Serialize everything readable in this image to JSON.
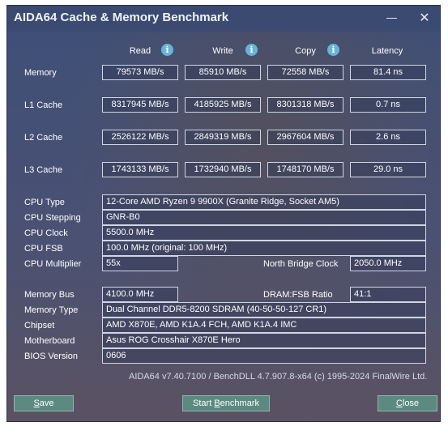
{
  "window": {
    "title": "AIDA64 Cache & Memory Benchmark",
    "minimize_icon": "minimize-icon",
    "close_icon": "close-icon",
    "close_glyph": "✕"
  },
  "columns": {
    "read": "Read",
    "write": "Write",
    "copy": "Copy",
    "latency": "Latency",
    "info_glyph": "i"
  },
  "bench": {
    "memory": {
      "label": "Memory",
      "read": "79573 MB/s",
      "write": "85910 MB/s",
      "copy": "72558 MB/s",
      "latency": "81.4 ns"
    },
    "l1": {
      "label": "L1 Cache",
      "read": "8317945 MB/s",
      "write": "4185925 MB/s",
      "copy": "8301318 MB/s",
      "latency": "0.7 ns"
    },
    "l2": {
      "label": "L2 Cache",
      "read": "2526122 MB/s",
      "write": "2849319 MB/s",
      "copy": "2967604 MB/s",
      "latency": "2.6 ns"
    },
    "l3": {
      "label": "L3 Cache",
      "read": "1743133 MB/s",
      "write": "1732940 MB/s",
      "copy": "1748170 MB/s",
      "latency": "29.0 ns"
    }
  },
  "cpu": {
    "type_label": "CPU Type",
    "type": "12-Core AMD Ryzen 9 9900X  (Granite Ridge, Socket AM5)",
    "stepping_label": "CPU Stepping",
    "stepping": "GNR-B0",
    "clock_label": "CPU Clock",
    "clock": "5500.0 MHz",
    "fsb_label": "CPU FSB",
    "fsb": "100.0 MHz  (original: 100 MHz)",
    "multiplier_label": "CPU Multiplier",
    "multiplier": "55x",
    "nb_clock_label": "North Bridge Clock",
    "nb_clock": "2050.0 MHz"
  },
  "memory": {
    "bus_label": "Memory Bus",
    "bus": "4100.0 MHz",
    "ratio_label": "DRAM:FSB Ratio",
    "ratio": "41:1",
    "type_label": "Memory Type",
    "type": "Dual Channel DDR5-8200 SDRAM  (40-50-50-127 CR1)",
    "chipset_label": "Chipset",
    "chipset": "AMD X870E, AMD K1A.4 FCH, AMD K1A.4 IMC",
    "motherboard_label": "Motherboard",
    "motherboard": "Asus ROG Crosshair X870E Hero",
    "bios_label": "BIOS Version",
    "bios": "0606"
  },
  "footer": "AIDA64 v7.40.7100 / BenchDLL 4.7.907.8-x64  (c) 1995-2024 FinalWire Ltd.",
  "buttons": {
    "save_u": "S",
    "save_rest": "ave",
    "start_pre": "Start ",
    "start_u": "B",
    "start_rest": "enchmark",
    "close_u": "C",
    "close_rest": "lose"
  },
  "colors": {
    "window_bg": "#3e4f78",
    "button_bg": "#5c8a80",
    "info_icon": "#66b5d8"
  }
}
